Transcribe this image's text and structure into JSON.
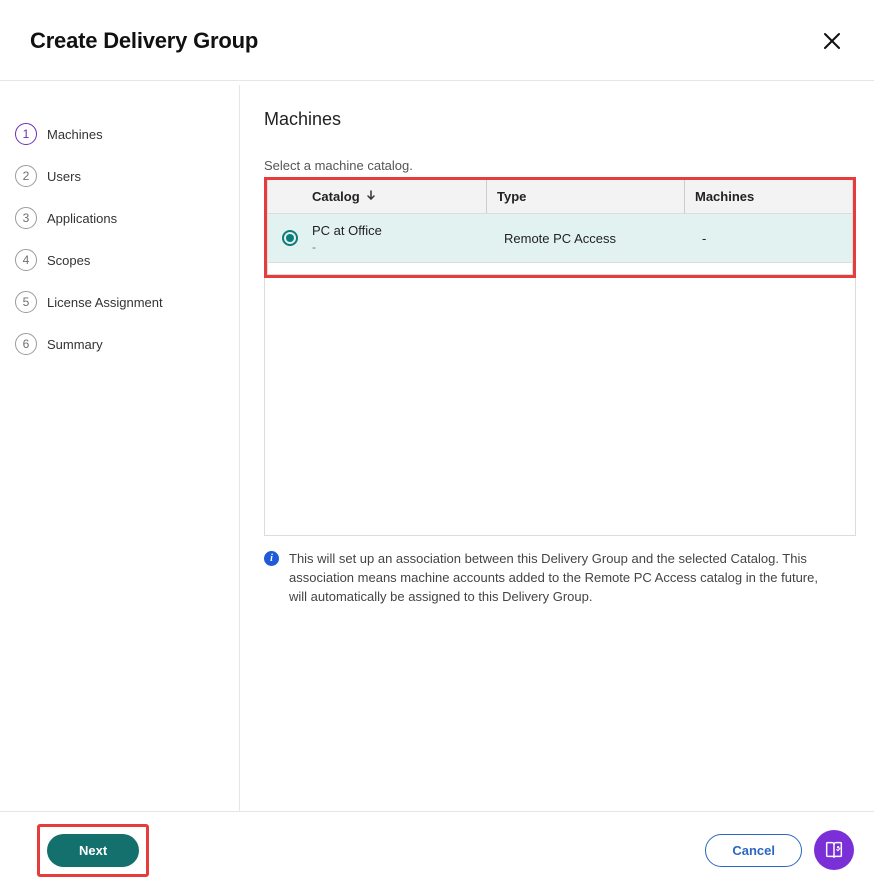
{
  "header": {
    "title": "Create Delivery Group"
  },
  "sidebar": {
    "steps": [
      {
        "num": "1",
        "label": "Machines",
        "active": true
      },
      {
        "num": "2",
        "label": "Users",
        "active": false
      },
      {
        "num": "3",
        "label": "Applications",
        "active": false
      },
      {
        "num": "4",
        "label": "Scopes",
        "active": false
      },
      {
        "num": "5",
        "label": "License Assignment",
        "active": false
      },
      {
        "num": "6",
        "label": "Summary",
        "active": false
      }
    ]
  },
  "main": {
    "title": "Machines",
    "instruction": "Select a machine catalog.",
    "columns": {
      "catalog": "Catalog",
      "type": "Type",
      "machines": "Machines"
    },
    "rows": [
      {
        "catalog_name": "PC at Office",
        "catalog_sub": "-",
        "type": "Remote PC Access",
        "machines": "-",
        "selected": true
      }
    ],
    "info_text": "This will set up an association between this Delivery Group and the selected Catalog. This association means machine accounts added to the Remote PC Access catalog in the future, will automatically be assigned to this Delivery Group."
  },
  "footer": {
    "next_label": "Next",
    "cancel_label": "Cancel"
  }
}
